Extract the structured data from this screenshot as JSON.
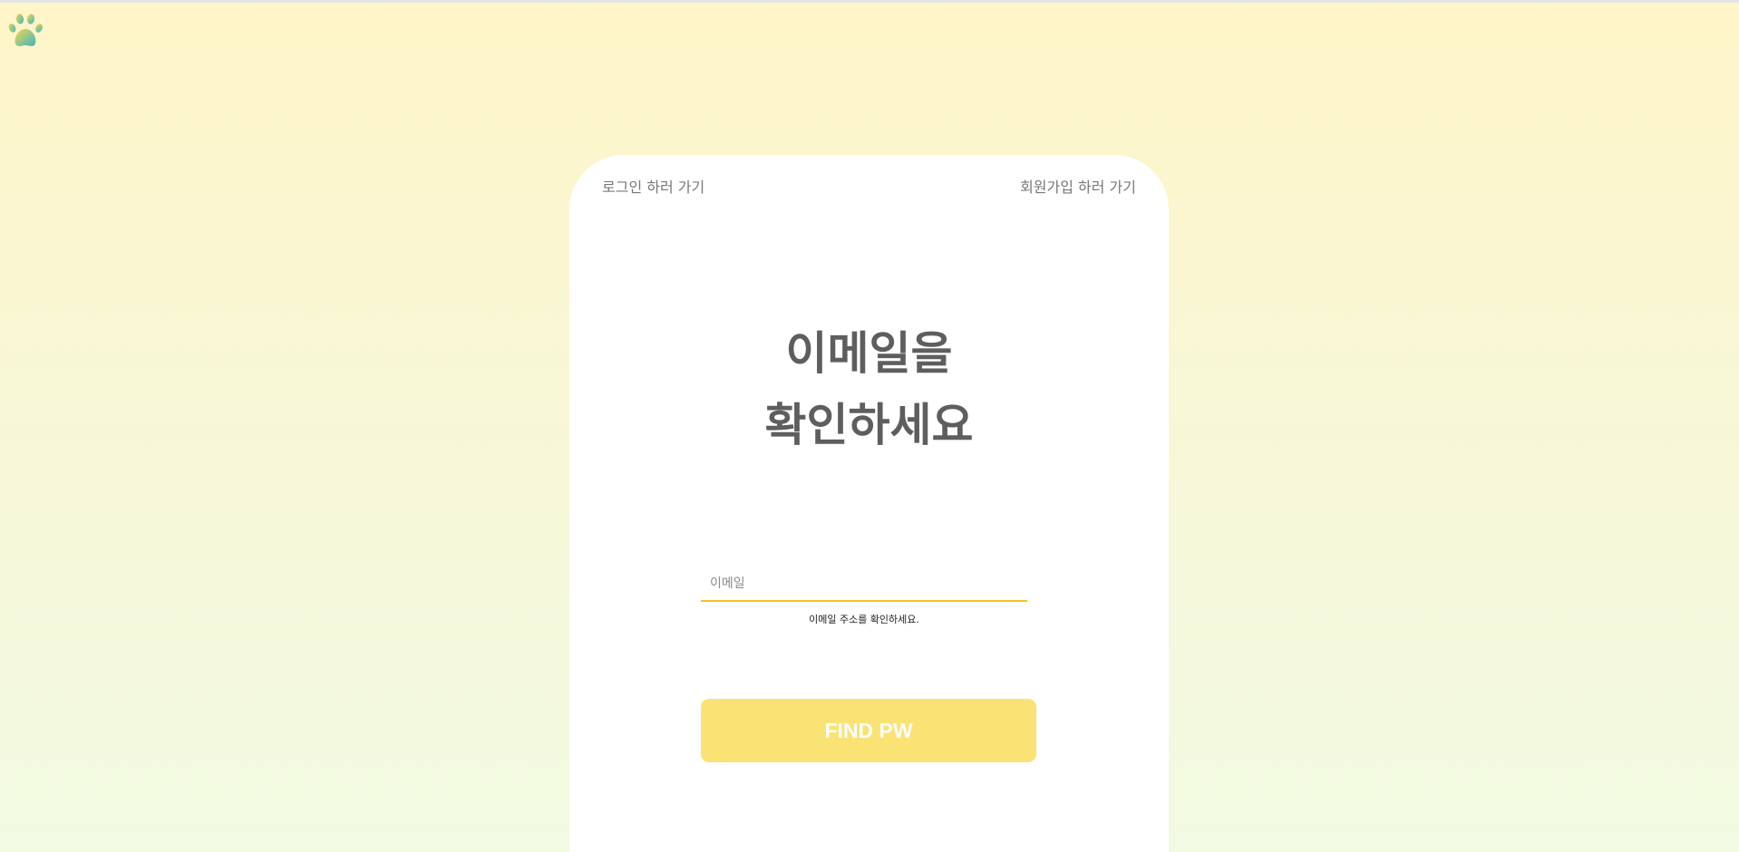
{
  "logo": {
    "icon": "paw-icon",
    "colors": [
      "#f5d64a",
      "#3bb7c6"
    ]
  },
  "nav": {
    "login_label": "로그인 하러 가기",
    "signup_label": "회원가입 하러 가기"
  },
  "heading": {
    "line1": "이메일을",
    "line2": "확인하세요"
  },
  "email": {
    "placeholder": "이메일",
    "value": "",
    "helper": "이메일 주소를 확인하세요."
  },
  "submit": {
    "label": "FIND PW"
  },
  "colors": {
    "accent": "#f3c321",
    "button": "#fbe274",
    "heading": "#5e5e5e"
  }
}
